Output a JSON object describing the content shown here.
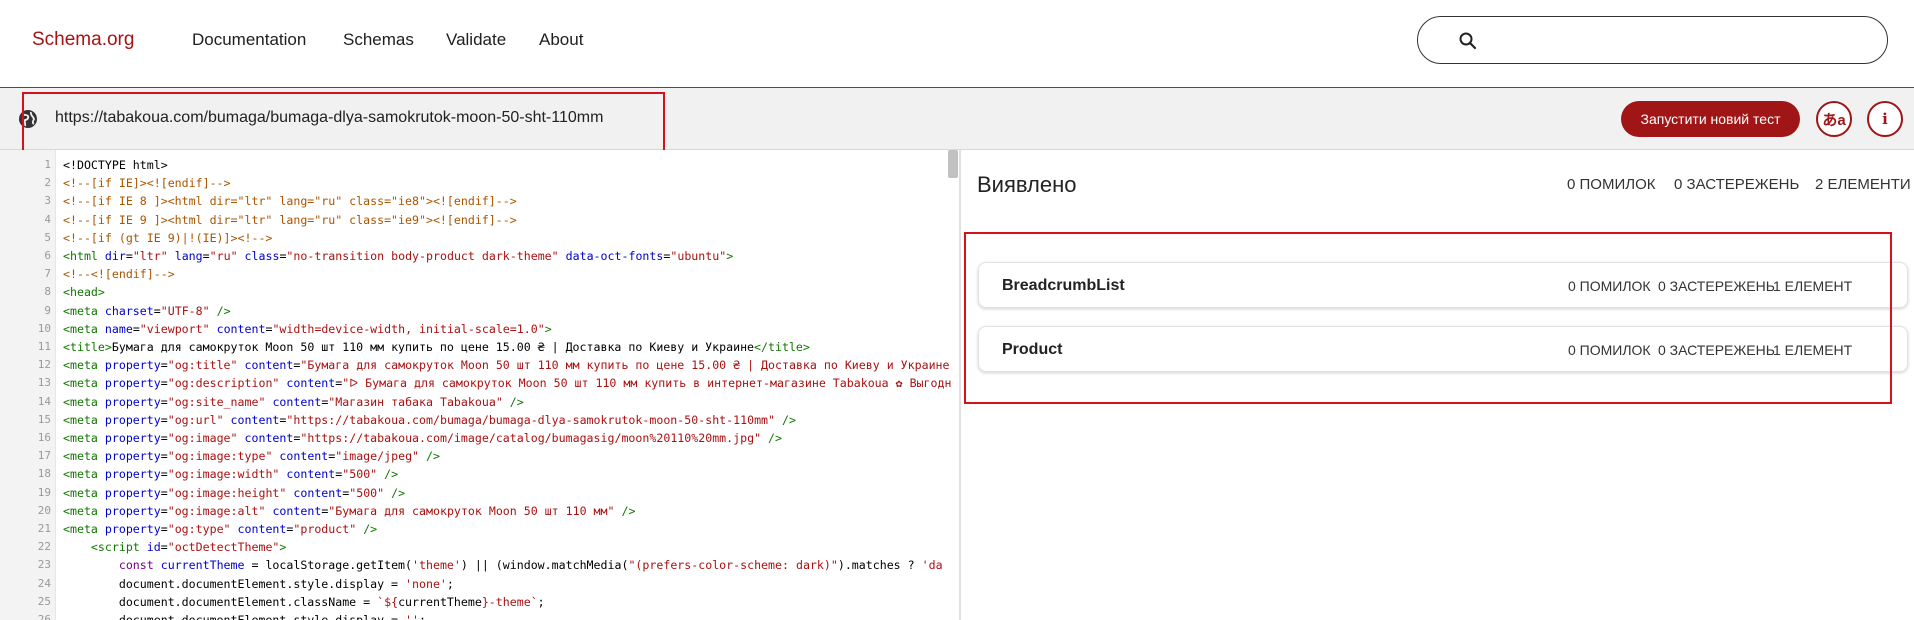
{
  "header": {
    "logo": "Schema.org",
    "nav": [
      "Documentation",
      "Schemas",
      "Validate",
      "About"
    ]
  },
  "urlbar": {
    "url": "https://tabakoua.com/bumaga/bumaga-dlya-samokrutok-moon-50-sht-110mm",
    "run_label": "Запустити новий тест",
    "lang_label": "あa",
    "info_label": "i"
  },
  "code_lines": [
    {
      "n": "1",
      "html": "&lt;!DOCTYPE html&gt;"
    },
    {
      "n": "2",
      "html": "<span class='cm'>&lt;!--[if IE]&gt;&lt;![endif]--&gt;</span>"
    },
    {
      "n": "3",
      "html": "<span class='cm'>&lt;!--[if IE 8 ]&gt;&lt;html dir=\"ltr\" lang=\"ru\" class=\"ie8\"&gt;&lt;![endif]--&gt;</span>"
    },
    {
      "n": "4",
      "html": "<span class='cm'>&lt;!--[if IE 9 ]&gt;&lt;html dir=\"ltr\" lang=\"ru\" class=\"ie9\"&gt;&lt;![endif]--&gt;</span>"
    },
    {
      "n": "5",
      "html": "<span class='cm'>&lt;!--[if (gt IE 9)|!(IE)]&gt;&lt;!--&gt;</span>"
    },
    {
      "n": "6",
      "html": "<span class='tag'>&lt;html</span> <span class='attr'>dir</span>=<span class='str'>\"ltr\"</span> <span class='attr'>lang</span>=<span class='str'>\"ru\"</span> <span class='attr'>class</span>=<span class='str'>\"no-transition body-product dark-theme\"</span> <span class='attr'>data-oct-fonts</span>=<span class='str'>\"ubuntu\"</span><span class='tag'>&gt;</span>"
    },
    {
      "n": "7",
      "html": "<span class='cm'>&lt;!--&lt;![endif]--&gt;</span>"
    },
    {
      "n": "8",
      "html": "<span class='tag'>&lt;head&gt;</span>"
    },
    {
      "n": "9",
      "html": "<span class='tag'>&lt;meta</span> <span class='attr'>charset</span>=<span class='str'>\"UTF-8\"</span> <span class='tag'>/&gt;</span>"
    },
    {
      "n": "10",
      "html": "<span class='tag'>&lt;meta</span> <span class='attr'>name</span>=<span class='str'>\"viewport\"</span> <span class='attr'>content</span>=<span class='str'>\"width=device-width, initial-scale=1.0\"</span><span class='tag'>&gt;</span>"
    },
    {
      "n": "11",
      "html": "<span class='tag'>&lt;title&gt;</span>Бумага для самокруток Moon 50 шт 110 мм купить по цене 15.00 ₴ | Доставка по Киеву и Украине<span class='tag'>&lt;/title&gt;</span>"
    },
    {
      "n": "12",
      "html": "<span class='tag'>&lt;meta</span> <span class='attr'>property</span>=<span class='str'>\"og:title\"</span> <span class='attr'>content</span>=<span class='str'>\"Бумага для самокруток Moon 50 шт 110 мм купить по цене 15.00 ₴ | Доставка по Киеву и Украине</span>"
    },
    {
      "n": "13",
      "html": "<span class='tag'>&lt;meta</span> <span class='attr'>property</span>=<span class='str'>\"og:description\"</span> <span class='attr'>content</span>=<span class='str'>\"ᐅ Бумага для самокруток Moon 50 шт 110 мм купить в интернет-магазине Tabakoua ✿ Выгодн</span>"
    },
    {
      "n": "14",
      "html": "<span class='tag'>&lt;meta</span> <span class='attr'>property</span>=<span class='str'>\"og:site_name\"</span> <span class='attr'>content</span>=<span class='str'>\"Магазин табака Tabakoua\"</span> <span class='tag'>/&gt;</span>"
    },
    {
      "n": "15",
      "html": "<span class='tag'>&lt;meta</span> <span class='attr'>property</span>=<span class='str'>\"og:url\"</span> <span class='attr'>content</span>=<span class='str'>\"https://tabakoua.com/bumaga/bumaga-dlya-samokrutok-moon-50-sht-110mm\"</span> <span class='tag'>/&gt;</span>"
    },
    {
      "n": "16",
      "html": "<span class='tag'>&lt;meta</span> <span class='attr'>property</span>=<span class='str'>\"og:image\"</span> <span class='attr'>content</span>=<span class='str'>\"https://tabakoua.com/image/catalog/bumagasig/moon%20110%20mm.jpg\"</span> <span class='tag'>/&gt;</span>"
    },
    {
      "n": "17",
      "html": "<span class='tag'>&lt;meta</span> <span class='attr'>property</span>=<span class='str'>\"og:image:type\"</span> <span class='attr'>content</span>=<span class='str'>\"image/jpeg\"</span> <span class='tag'>/&gt;</span>"
    },
    {
      "n": "18",
      "html": "<span class='tag'>&lt;meta</span> <span class='attr'>property</span>=<span class='str'>\"og:image:width\"</span> <span class='attr'>content</span>=<span class='str'>\"500\"</span> <span class='tag'>/&gt;</span>"
    },
    {
      "n": "19",
      "html": "<span class='tag'>&lt;meta</span> <span class='attr'>property</span>=<span class='str'>\"og:image:height\"</span> <span class='attr'>content</span>=<span class='str'>\"500\"</span> <span class='tag'>/&gt;</span>"
    },
    {
      "n": "20",
      "html": "<span class='tag'>&lt;meta</span> <span class='attr'>property</span>=<span class='str'>\"og:image:alt\"</span> <span class='attr'>content</span>=<span class='str'>\"Бумага для самокруток Moon 50 шт 110 мм\"</span> <span class='tag'>/&gt;</span>"
    },
    {
      "n": "21",
      "html": "<span class='tag'>&lt;meta</span> <span class='attr'>property</span>=<span class='str'>\"og:type\"</span> <span class='attr'>content</span>=<span class='str'>\"product\"</span> <span class='tag'>/&gt;</span>"
    },
    {
      "n": "22",
      "html": "    <span class='tag'>&lt;script</span> <span class='attr'>id</span>=<span class='str'>\"octDetectTheme\"</span><span class='tag'>&gt;</span>"
    },
    {
      "n": "23",
      "html": "        <span class='kw'>const</span> <span class='attr'>currentTheme</span> = localStorage.getItem(<span class='str'>'theme'</span>) || (window.matchMedia(<span class='str'>\"(prefers-color-scheme: dark)\"</span>).matches ? <span class='str'>'da</span>"
    },
    {
      "n": "24",
      "html": "        document.documentElement.style.display = <span class='str'>'none'</span>;"
    },
    {
      "n": "25",
      "html": "        document.documentElement.className = <span class='str'>`${</span>currentTheme<span class='str'>}-theme`</span>;"
    },
    {
      "n": "26",
      "html": "        document.documentElement.style.display = <span class='str'>''</span>;"
    }
  ],
  "results": {
    "title": "Виявлено",
    "errors": "0 ПОМИЛОК",
    "warnings": "0 ЗАСТЕРЕЖЕНЬ",
    "items": "2 ЕЛЕМЕНТИ",
    "cards": [
      {
        "name": "BreadcrumbList",
        "errors": "0 ПОМИЛОК",
        "warnings": "0 ЗАСТЕРЕЖЕНЬ",
        "items": "1 ЕЛЕМЕНТ"
      },
      {
        "name": "Product",
        "errors": "0 ПОМИЛОК",
        "warnings": "0 ЗАСТЕРЕЖЕНЬ",
        "items": "1 ЕЛЕМЕНТ"
      }
    ]
  },
  "colors": {
    "accent": "#a01616",
    "highlight": "#d4121a"
  }
}
